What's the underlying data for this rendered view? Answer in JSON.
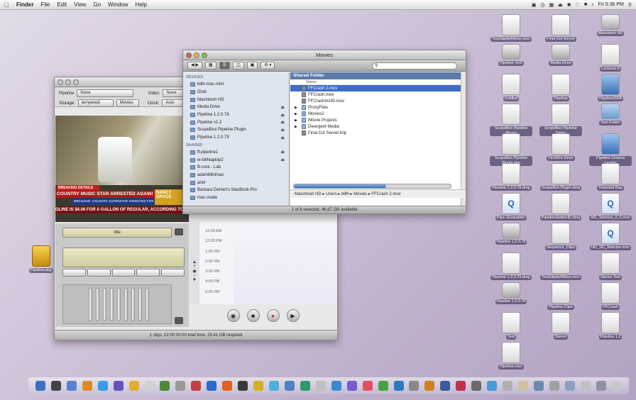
{
  "menubar": {
    "app": "Finder",
    "items": [
      "File",
      "Edit",
      "View",
      "Go",
      "Window",
      "Help"
    ],
    "clock": "Fri 5:36 PM"
  },
  "desktop_icons": [
    {
      "label": "Test2dipfa4Wizer.mov",
      "kind": "doc"
    },
    {
      "label": "Final Cut Server",
      "kind": "cube"
    },
    {
      "label": "Macintosh HD",
      "kind": "drive"
    },
    {
      "label": "Pipeline Vol2",
      "kind": "disc"
    },
    {
      "label": "Media Drive",
      "kind": "drive"
    },
    {
      "label": "Lectures.b",
      "kind": "doc"
    },
    {
      "label": "Untitled",
      "kind": "doc"
    },
    {
      "label": "Pipeline",
      "kind": "doc"
    },
    {
      "label": "Pipeline2008",
      "kind": "blue"
    },
    {
      "label": "ScopeBox Pipeline Plugin",
      "kind": "doc"
    },
    {
      "label": "ScopeBox Pipeline Demo",
      "kind": "doc"
    },
    {
      "label": "Sort Folder",
      "kind": "folder"
    },
    {
      "label": "ScopeBox Pipeline Plugin.pkg",
      "kind": "doc"
    },
    {
      "label": "FireWire Drive",
      "kind": "doc"
    },
    {
      "label": "Pipeline Cinema Leader",
      "kind": "blue"
    },
    {
      "label": "Pipeline 1.2.0.79.dmg",
      "kind": "doc"
    },
    {
      "label": "ScopeBox Plugin.dmg",
      "kind": "doc"
    },
    {
      "label": "Imported Bag",
      "kind": "doc"
    },
    {
      "label": "Pipe-1Evauation",
      "kind": "q"
    },
    {
      "label": "PipelineSetterHD.dmg",
      "kind": "doc"
    },
    {
      "label": "HD_Telecine_5_6.mov",
      "kind": "q"
    },
    {
      "label": "Pipeline 1.2.0.78",
      "kind": "drive"
    },
    {
      "label": "Sequence_Clips",
      "kind": "doc"
    },
    {
      "label": "HD_SD_Telecine.mov",
      "kind": "q"
    },
    {
      "label": "Pipeline 1.2.0.79.dmg",
      "kind": "doc"
    },
    {
      "label": "Test2dipfa4Wizer.mov",
      "kind": "doc"
    },
    {
      "label": "Stereo Test",
      "kind": "doc"
    },
    {
      "label": "Pipeline 1.2.0.78",
      "kind": "drive"
    },
    {
      "label": "Pipeline Clips",
      "kind": "doc"
    },
    {
      "label": "FFCrash",
      "kind": "doc"
    },
    {
      "label": "Test",
      "kind": "doc"
    },
    {
      "label": "Stereo",
      "kind": "doc"
    },
    {
      "label": "Pipeline 1.2",
      "kind": "doc"
    },
    {
      "label": "Pipeline.mov",
      "kind": "doc"
    }
  ],
  "left_icon": {
    "label": "Pipeline.pkg"
  },
  "finder": {
    "title": "Movies",
    "search_placeholder": "",
    "sidebar": {
      "devices_header": "DEVICES",
      "devices": [
        "billh-mac-mini",
        "iDisk",
        "Macintosh HD",
        "Media Drive",
        "Pipeline 1.2.0.78",
        "Pipeline v1.2",
        "ScopeBox Pipeline Plugin",
        "Pipeline 1.2.0.79"
      ],
      "shared_header": "SHARED",
      "shared": [
        "ff-pipeline1",
        "w-billhlaptop2",
        "B-core - Lab",
        "adamMinimac",
        "ariel",
        "Barbara DeHart's MacBook Pro",
        "mac-matte"
      ]
    },
    "column_header": "Shared Folder",
    "column_sub": "Name",
    "files": [
      {
        "name": "FFCrash 2.mov",
        "folder": false,
        "selected": true
      },
      {
        "name": "FFCrash.mov",
        "folder": false,
        "selected": false
      },
      {
        "name": "FFCrashmx30.mov",
        "folder": false,
        "selected": false
      },
      {
        "name": "ProxyFiles",
        "folder": true,
        "selected": false
      },
      {
        "name": "Movies2",
        "folder": true,
        "selected": false
      },
      {
        "name": "iMovie Projects",
        "folder": true,
        "selected": false
      },
      {
        "name": "Divergent Media",
        "folder": true,
        "selected": false
      },
      {
        "name": "Final Cut Server.fclp",
        "folder": false,
        "selected": false
      }
    ],
    "path": "Macintosh HD ▸ Users ▸ billh ▸ Movies ▸ FFCrash 2.mov",
    "status": "1 of 8 selected, 46.87 GB available"
  },
  "pipeline": {
    "pipeline_label": "Pipeline",
    "pipeline_value": "None",
    "video_label": "Video:",
    "video_value": "None",
    "storage_label": "Storage:",
    "storage_value": "larrywood",
    "storage_folder": "Movies",
    "clock_label": "Clock:",
    "clock_value": "Auto",
    "news_header": "BREAKING DETAILS",
    "news_headline": "COUNTRY MUSIC STAR ARRESTED AGAIN!",
    "news_sub": "BREAKING: COUNTRY SUPERSTAR ARRESTED FOR RELEASE",
    "news_name": "NANCY GRACE",
    "news_ticker": "OLINE IS $4.06 FOR A GALLON OF REGULAR, ACCORDING TO",
    "lcd_text": "Idle",
    "times": [
      "12:00 AM",
      "12:00 PM",
      "1:00 PM",
      "2:00 PM",
      "3:00 PM",
      "4:00 PM",
      "5:00 PM"
    ],
    "status": "1 clips, 02:00:00:00 total time, 25.41 GB required"
  }
}
